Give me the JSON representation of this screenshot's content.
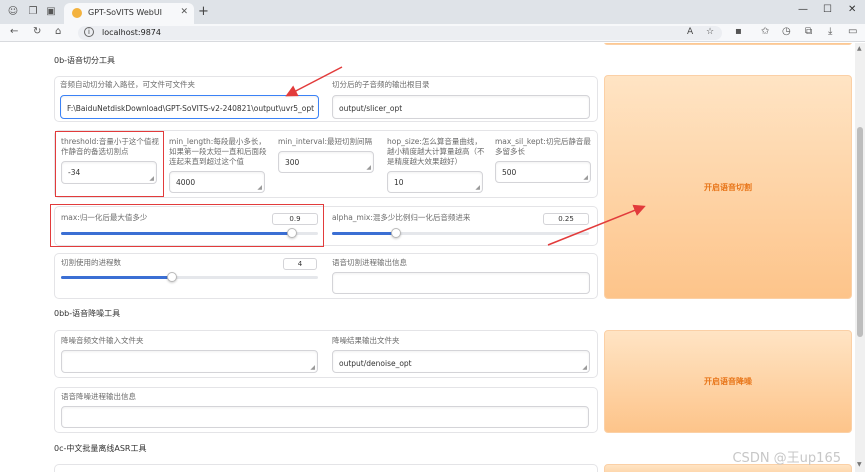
{
  "browser": {
    "tab_title": "GPT-SoVITS WebUI",
    "url": "localhost:9874"
  },
  "slicer": {
    "section_title": "0b-语音切分工具",
    "input_path_label": "音频自动切分输入路径，可文件可文件夹",
    "input_path_value": "F:\\BaiduNetdiskDownload\\GPT-SoVITS-v2-240821\\output\\uvr5_opt",
    "output_dir_label": "切分后的子音频的输出根目录",
    "output_dir_value": "output/slicer_opt",
    "threshold_label": "threshold:音量小于这个值视作静音的备选切割点",
    "threshold_value": "-34",
    "min_length_label": "min_length:每段最小多长，如果第一段太短一直和后面段连起来直到超过这个值",
    "min_length_value": "4000",
    "min_interval_label": "min_interval:最短切割间隔",
    "min_interval_value": "300",
    "hop_size_label": "hop_size:怎么算音量曲线，越小精度越大计算量越高（不是精度越大效果越好）",
    "hop_size_value": "10",
    "max_sil_kept_label": "max_sil_kept:切完后静音最多留多长",
    "max_sil_kept_value": "500",
    "max_label": "max:归一化后最大值多少",
    "max_value": "0.9",
    "max_fraction": 0.9,
    "alpha_mix_label": "alpha_mix:混多少比例归一化后音频进来",
    "alpha_mix_value": "0.25",
    "alpha_mix_fraction": 0.25,
    "processes_label": "切割使用的进程数",
    "processes_value": "4",
    "processes_fraction": 0.43,
    "output_info_label": "语音切割进程输出信息",
    "button_label": "开启语音切割"
  },
  "denoise": {
    "section_title": "0bb-语音降噪工具",
    "input_label": "降噪音频文件输入文件夹",
    "input_value": "",
    "output_label": "降噪结果输出文件夹",
    "output_value": "output/denoise_opt",
    "info_label": "语音降噪进程输出信息",
    "button_label": "开启语音降噪"
  },
  "asr": {
    "section_title": "0c-中文批量离线ASR工具"
  },
  "watermark": "CSDN @王up165",
  "colors": {
    "accent": "#3b6fd4",
    "button_text": "#e8761a",
    "annotation_red": "#e23b3b"
  }
}
